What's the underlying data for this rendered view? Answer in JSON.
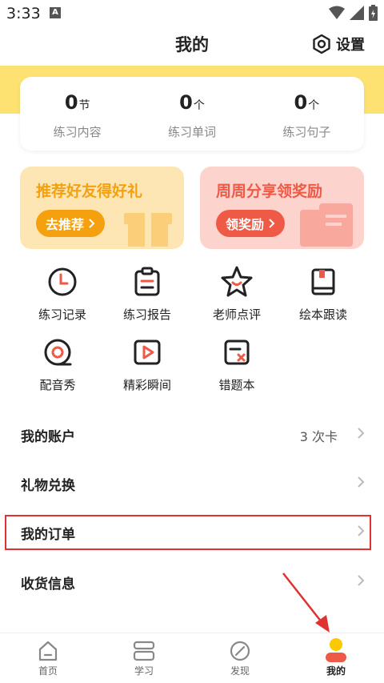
{
  "status_bar": {
    "time": "3:33",
    "badge": "A"
  },
  "header": {
    "title": "我的",
    "settings_label": "设置"
  },
  "stats": [
    {
      "value": "0",
      "unit": "节",
      "label": "练习内容"
    },
    {
      "value": "0",
      "unit": "个",
      "label": "练习单词"
    },
    {
      "value": "0",
      "unit": "个",
      "label": "练习句子"
    }
  ],
  "promos": {
    "left": {
      "title": "推荐好友得好礼",
      "button": "去推荐",
      "color": "#f5a10f"
    },
    "right": {
      "title": "周周分享领奖励",
      "button": "领奖励",
      "color": "#ef5a47"
    }
  },
  "features": [
    {
      "label": "练习记录",
      "icon": "clock-icon"
    },
    {
      "label": "练习报告",
      "icon": "report-icon"
    },
    {
      "label": "老师点评",
      "icon": "star-icon"
    },
    {
      "label": "绘本跟读",
      "icon": "book-icon"
    },
    {
      "label": "配音秀",
      "icon": "tape-icon"
    },
    {
      "label": "精彩瞬间",
      "icon": "play-icon"
    },
    {
      "label": "错题本",
      "icon": "wrong-book-icon"
    }
  ],
  "menu": [
    {
      "label": "我的账户",
      "value": "3 次卡"
    },
    {
      "label": "礼物兑换",
      "value": ""
    },
    {
      "label": "我的订单",
      "value": ""
    },
    {
      "label": "收货信息",
      "value": ""
    }
  ],
  "tabs": [
    {
      "label": "首页",
      "icon": "home-icon"
    },
    {
      "label": "学习",
      "icon": "study-icon"
    },
    {
      "label": "发现",
      "icon": "discover-icon"
    },
    {
      "label": "我的",
      "icon": "profile-icon",
      "active": true
    }
  ],
  "colors": {
    "accent_yellow": "#fde272",
    "orange": "#f5a10f",
    "red": "#ef5a47",
    "highlight": "#e03232"
  }
}
